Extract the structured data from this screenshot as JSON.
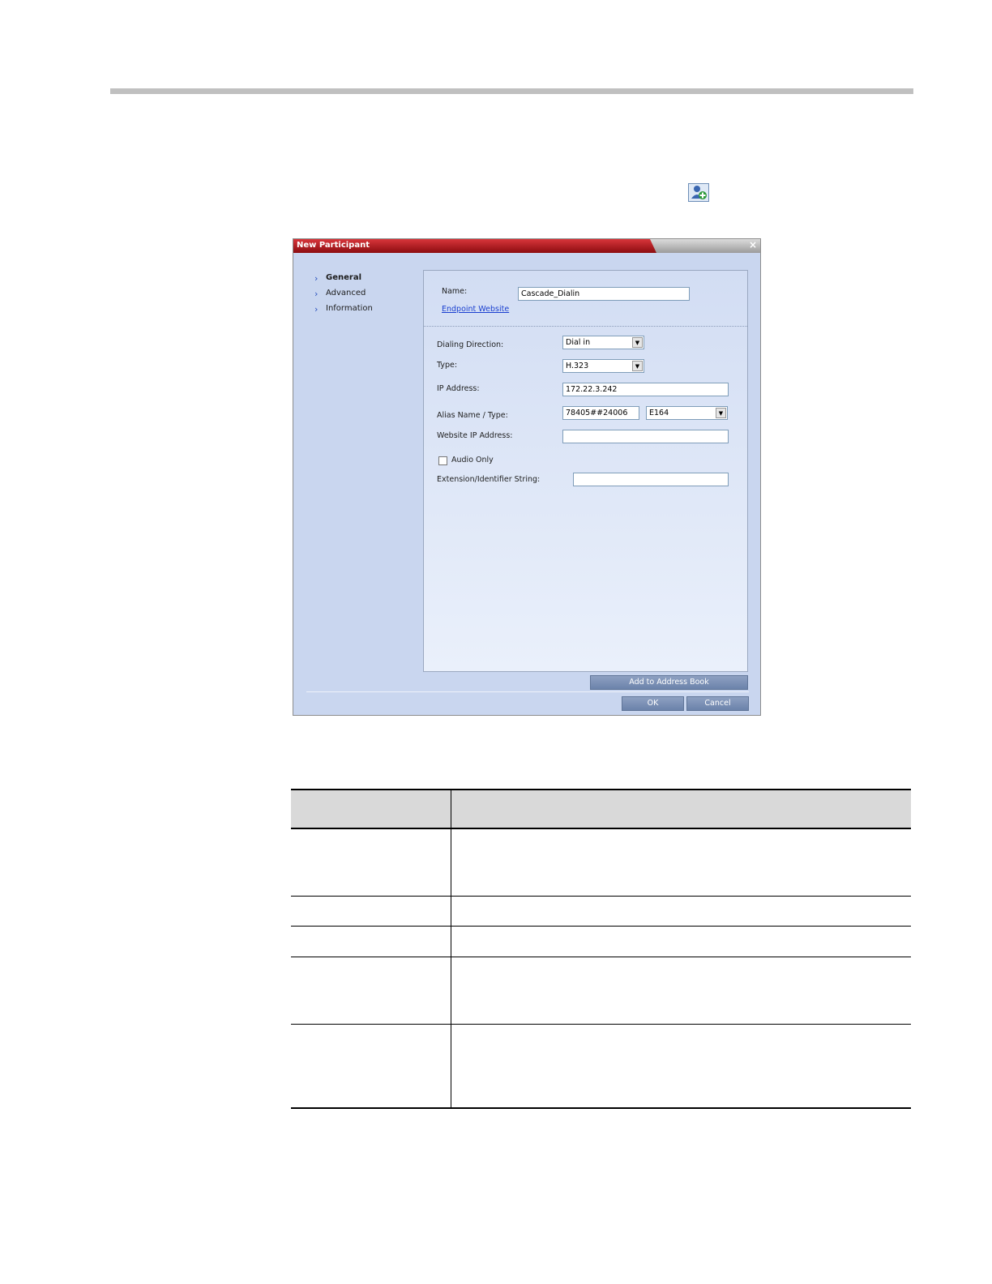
{
  "dialog": {
    "title": "New Participant",
    "close_symbol": "×",
    "sidebar": [
      {
        "label": "General",
        "active": true
      },
      {
        "label": "Advanced",
        "active": false
      },
      {
        "label": "Information",
        "active": false
      }
    ],
    "general": {
      "name_label": "Name:",
      "name_value": "Cascade_Dialin",
      "endpoint_link": "Endpoint Website",
      "dialing_direction_label": "Dialing Direction:",
      "dialing_direction_value": "Dial in",
      "type_label": "Type:",
      "type_value": "H.323",
      "ip_label": "IP Address:",
      "ip_value": "172.22.3.242",
      "alias_label": "Alias Name / Type:",
      "alias_value": "78405##24006",
      "alias_type_value": "E164",
      "website_ip_label": "Website IP Address:",
      "website_ip_value": "",
      "audio_only_label": "Audio Only",
      "extension_label": "Extension/Identifier String:",
      "extension_value": ""
    },
    "buttons": {
      "add_to_address_book": "Add to Address Book",
      "ok": "OK",
      "cancel": "Cancel"
    }
  },
  "icons": {
    "toolbar": "new-participant-icon",
    "sidebar_arrow": "chevron-right-icon",
    "dropdown": "chevron-down-icon"
  },
  "colors": {
    "title_red": "#b3161b",
    "dialog_bg": "#c9d6ef",
    "button_blue": "#7b90b6"
  }
}
